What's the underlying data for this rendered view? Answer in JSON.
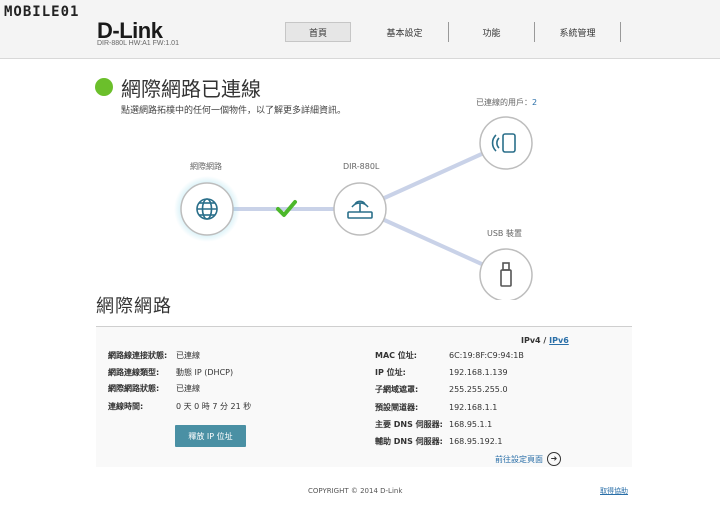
{
  "watermark": "MOBILE01",
  "brand": {
    "logo": "D-Link",
    "model": "DIR-880L    HW:A1    FW:1.01"
  },
  "nav": {
    "tabs": [
      "首頁",
      "基本設定",
      "功能",
      "系統管理"
    ]
  },
  "status": {
    "title": "網際網路已連線",
    "description": "點選網路拓樸中的任何一個物件，以了解更多詳細資訊。"
  },
  "topology": {
    "internet_label": "網際網路",
    "router_label": "DIR-880L",
    "clients_label": "已連線的用戶：",
    "clients_count": "2",
    "usb_label": "USB 裝置"
  },
  "section": {
    "title": "網際網路"
  },
  "ip_version": {
    "v4": "IPv4",
    "sep": "/",
    "v6": "IPv6"
  },
  "left_info": [
    {
      "key": "網路線連接狀態:",
      "value": "已連線"
    },
    {
      "key": "網路連線類型:",
      "value": "動態 IP (DHCP)"
    },
    {
      "key": "網際網路狀態:",
      "value": "已連線"
    },
    {
      "key": "連線時間:",
      "value": "0 天 0 時 7 分 21 秒"
    }
  ],
  "right_info": [
    {
      "key": "MAC 位址:",
      "value": "6C:19:8F:C9:94:1B"
    },
    {
      "key": "IP 位址:",
      "value": "192.168.1.139"
    },
    {
      "key": "子網域遮罩:",
      "value": "255.255.255.0"
    },
    {
      "key": "預設閘道器:",
      "value": "192.168.1.1"
    },
    {
      "key": "主要 DNS 伺服器:",
      "value": "168.95.1.1"
    },
    {
      "key": "輔助 DNS 伺服器:",
      "value": "168.95.192.1"
    }
  ],
  "release_button": "釋放 IP 位址",
  "goto_settings": "前往設定頁面",
  "footer": {
    "copyright": "COPYRIGHT © 2014 D-Link",
    "help": "取得協助"
  },
  "colors": {
    "status_green": "#6bbf2b",
    "button_blue": "#4a90a4",
    "link_blue": "#2a6fa8",
    "check_green": "#4cb82a"
  }
}
